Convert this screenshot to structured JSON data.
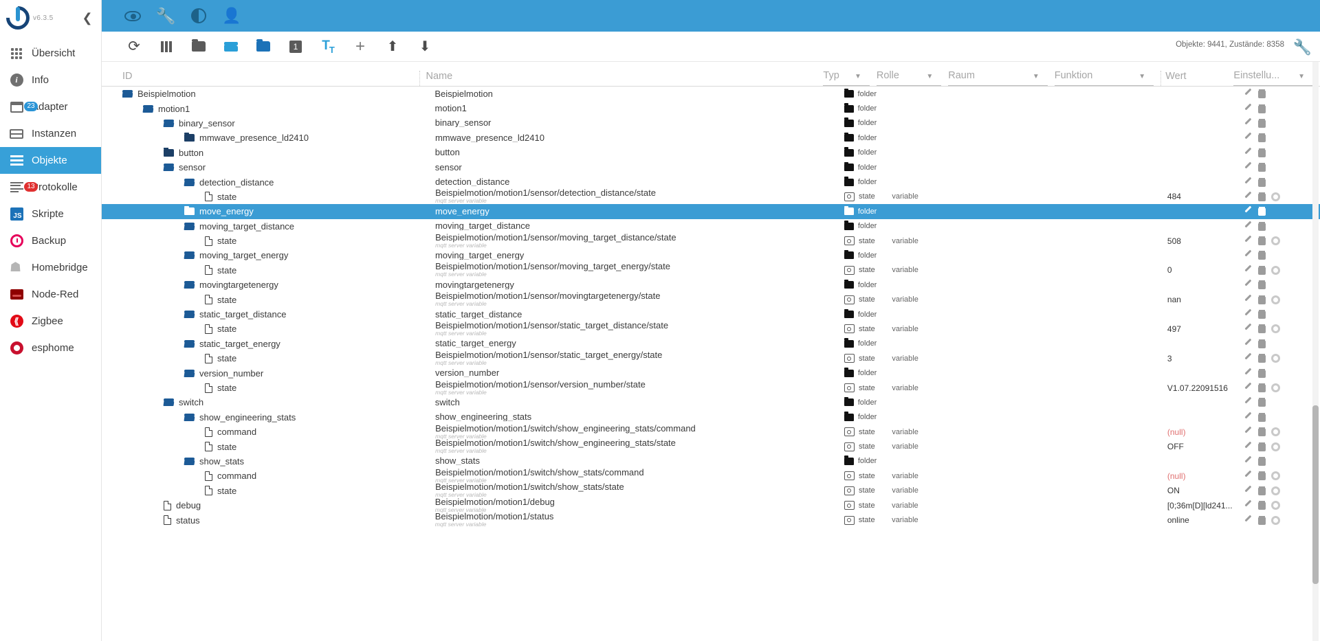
{
  "sidebar": {
    "version": "v6.3.5",
    "collapse_icon": "chevron-left-icon",
    "items": [
      {
        "label": "Übersicht",
        "icon": "grid-icon",
        "active": false,
        "badge": null
      },
      {
        "label": "Info",
        "icon": "info-icon",
        "active": false,
        "badge": null
      },
      {
        "label": "Adapter",
        "icon": "adapter-icon",
        "active": false,
        "badge": "23",
        "badge_color": "#2a94d6"
      },
      {
        "label": "Instanzen",
        "icon": "instance-icon",
        "active": false,
        "badge": null
      },
      {
        "label": "Objekte",
        "icon": "objects-icon",
        "active": true,
        "badge": null
      },
      {
        "label": "Protokolle",
        "icon": "logs-icon",
        "active": false,
        "badge": "13",
        "badge_color": "#e03030"
      },
      {
        "label": "Skripte",
        "icon": "scripts-icon",
        "active": false,
        "badge": null
      },
      {
        "label": "Backup",
        "icon": "backup-icon",
        "active": false,
        "badge": null
      },
      {
        "label": "Homebridge",
        "icon": "homebridge-icon",
        "active": false,
        "badge": null
      },
      {
        "label": "Node-Red",
        "icon": "nodered-icon",
        "active": false,
        "badge": null
      },
      {
        "label": "Zigbee",
        "icon": "zigbee-icon",
        "active": false,
        "badge": null
      },
      {
        "label": "esphome",
        "icon": "esphome-icon",
        "active": false,
        "badge": null
      }
    ]
  },
  "topbar": {
    "accent": "#3b9cd4",
    "icons": [
      "eye-icon",
      "wrench-icon",
      "contrast-icon",
      "user-icon"
    ]
  },
  "toolbar": {
    "icons": [
      "refresh-icon",
      "columns-icon",
      "folder-closed-icon",
      "folder-open-icon",
      "folder-blue-icon",
      "expand-level-1-icon",
      "text-size-icon",
      "plus-icon",
      "upload-icon",
      "download-icon"
    ],
    "expand_level": "1",
    "counts": "Objekte: 9441, Zustände: 8358",
    "settings_icon": "wrench-icon"
  },
  "columns": {
    "id": "ID",
    "name": "Name",
    "typ": "Typ",
    "rolle": "Rolle",
    "raum": "Raum",
    "funktion": "Funktion",
    "wert": "Wert",
    "einstellungen": "Einstellu..."
  },
  "rows": [
    {
      "id": "Beispielmotion",
      "indent": 0,
      "icon": "folder-open-icon",
      "name": "Beispielmotion",
      "sub": "",
      "typ": "folder",
      "typ_icon": "folder-icon",
      "role": "",
      "value": "",
      "gear": false,
      "selected": false
    },
    {
      "id": "motion1",
      "indent": 1,
      "icon": "folder-open-icon",
      "name": "motion1",
      "sub": "",
      "typ": "folder",
      "typ_icon": "folder-icon",
      "role": "",
      "value": "",
      "gear": false,
      "selected": false
    },
    {
      "id": "binary_sensor",
      "indent": 2,
      "icon": "folder-open-icon",
      "name": "binary_sensor",
      "sub": "",
      "typ": "folder",
      "typ_icon": "folder-icon",
      "role": "",
      "value": "",
      "gear": false,
      "selected": false
    },
    {
      "id": "mmwave_presence_ld2410",
      "indent": 3,
      "icon": "folder-closed-icon",
      "name": "mmwave_presence_ld2410",
      "sub": "",
      "typ": "folder",
      "typ_icon": "folder-icon",
      "role": "",
      "value": "",
      "gear": false,
      "selected": false
    },
    {
      "id": "button",
      "indent": 2,
      "icon": "folder-closed-icon",
      "name": "button",
      "sub": "",
      "typ": "folder",
      "typ_icon": "folder-icon",
      "role": "",
      "value": "",
      "gear": false,
      "selected": false
    },
    {
      "id": "sensor",
      "indent": 2,
      "icon": "folder-open-icon",
      "name": "sensor",
      "sub": "",
      "typ": "folder",
      "typ_icon": "folder-icon",
      "role": "",
      "value": "",
      "gear": false,
      "selected": false
    },
    {
      "id": "detection_distance",
      "indent": 3,
      "icon": "folder-open-icon",
      "name": "detection_distance",
      "sub": "",
      "typ": "folder",
      "typ_icon": "folder-icon",
      "role": "",
      "value": "",
      "gear": false,
      "selected": false
    },
    {
      "id": "state",
      "indent": 4,
      "icon": "file-icon",
      "name": "Beispielmotion/motion1/sensor/detection_distance/state",
      "sub": "mqtt server variable",
      "typ": "state",
      "typ_icon": "state-icon",
      "role": "variable",
      "value": "484",
      "gear": true,
      "selected": false
    },
    {
      "id": "move_energy",
      "indent": 3,
      "icon": "folder-closed-icon",
      "name": "move_energy",
      "sub": "",
      "typ": "folder",
      "typ_icon": "folder-icon",
      "role": "",
      "value": "",
      "gear": false,
      "selected": true
    },
    {
      "id": "moving_target_distance",
      "indent": 3,
      "icon": "folder-open-icon",
      "name": "moving_target_distance",
      "sub": "",
      "typ": "folder",
      "typ_icon": "folder-icon",
      "role": "",
      "value": "",
      "gear": false,
      "selected": false
    },
    {
      "id": "state",
      "indent": 4,
      "icon": "file-icon",
      "name": "Beispielmotion/motion1/sensor/moving_target_distance/state",
      "sub": "mqtt server variable",
      "typ": "state",
      "typ_icon": "state-icon",
      "role": "variable",
      "value": "508",
      "gear": true,
      "selected": false
    },
    {
      "id": "moving_target_energy",
      "indent": 3,
      "icon": "folder-open-icon",
      "name": "moving_target_energy",
      "sub": "",
      "typ": "folder",
      "typ_icon": "folder-icon",
      "role": "",
      "value": "",
      "gear": false,
      "selected": false
    },
    {
      "id": "state",
      "indent": 4,
      "icon": "file-icon",
      "name": "Beispielmotion/motion1/sensor/moving_target_energy/state",
      "sub": "mqtt server variable",
      "typ": "state",
      "typ_icon": "state-icon",
      "role": "variable",
      "value": "0",
      "gear": true,
      "selected": false
    },
    {
      "id": "movingtargetenergy",
      "indent": 3,
      "icon": "folder-open-icon",
      "name": "movingtargetenergy",
      "sub": "",
      "typ": "folder",
      "typ_icon": "folder-icon",
      "role": "",
      "value": "",
      "gear": false,
      "selected": false
    },
    {
      "id": "state",
      "indent": 4,
      "icon": "file-icon",
      "name": "Beispielmotion/motion1/sensor/movingtargetenergy/state",
      "sub": "mqtt server variable",
      "typ": "state",
      "typ_icon": "state-icon",
      "role": "variable",
      "value": "nan",
      "gear": true,
      "selected": false
    },
    {
      "id": "static_target_distance",
      "indent": 3,
      "icon": "folder-open-icon",
      "name": "static_target_distance",
      "sub": "",
      "typ": "folder",
      "typ_icon": "folder-icon",
      "role": "",
      "value": "",
      "gear": false,
      "selected": false
    },
    {
      "id": "state",
      "indent": 4,
      "icon": "file-icon",
      "name": "Beispielmotion/motion1/sensor/static_target_distance/state",
      "sub": "mqtt server variable",
      "typ": "state",
      "typ_icon": "state-icon",
      "role": "variable",
      "value": "497",
      "gear": true,
      "selected": false
    },
    {
      "id": "static_target_energy",
      "indent": 3,
      "icon": "folder-open-icon",
      "name": "static_target_energy",
      "sub": "",
      "typ": "folder",
      "typ_icon": "folder-icon",
      "role": "",
      "value": "",
      "gear": false,
      "selected": false
    },
    {
      "id": "state",
      "indent": 4,
      "icon": "file-icon",
      "name": "Beispielmotion/motion1/sensor/static_target_energy/state",
      "sub": "mqtt server variable",
      "typ": "state",
      "typ_icon": "state-icon",
      "role": "variable",
      "value": "3",
      "gear": true,
      "selected": false
    },
    {
      "id": "version_number",
      "indent": 3,
      "icon": "folder-open-icon",
      "name": "version_number",
      "sub": "",
      "typ": "folder",
      "typ_icon": "folder-icon",
      "role": "",
      "value": "",
      "gear": false,
      "selected": false
    },
    {
      "id": "state",
      "indent": 4,
      "icon": "file-icon",
      "name": "Beispielmotion/motion1/sensor/version_number/state",
      "sub": "mqtt server variable",
      "typ": "state",
      "typ_icon": "state-icon",
      "role": "variable",
      "value": "V1.07.22091516",
      "gear": true,
      "selected": false
    },
    {
      "id": "switch",
      "indent": 2,
      "icon": "folder-open-icon",
      "name": "switch",
      "sub": "",
      "typ": "folder",
      "typ_icon": "folder-icon",
      "role": "",
      "value": "",
      "gear": false,
      "selected": false
    },
    {
      "id": "show_engineering_stats",
      "indent": 3,
      "icon": "folder-open-icon",
      "name": "show_engineering_stats",
      "sub": "",
      "typ": "folder",
      "typ_icon": "folder-icon",
      "role": "",
      "value": "",
      "gear": false,
      "selected": false
    },
    {
      "id": "command",
      "indent": 4,
      "icon": "file-icon",
      "name": "Beispielmotion/motion1/switch/show_engineering_stats/command",
      "sub": "mqtt server variable",
      "typ": "state",
      "typ_icon": "state-icon",
      "role": "variable",
      "value": "(null)",
      "value_null": true,
      "gear": true,
      "selected": false
    },
    {
      "id": "state",
      "indent": 4,
      "icon": "file-icon",
      "name": "Beispielmotion/motion1/switch/show_engineering_stats/state",
      "sub": "mqtt server variable",
      "typ": "state",
      "typ_icon": "state-icon",
      "role": "variable",
      "value": "OFF",
      "gear": true,
      "selected": false
    },
    {
      "id": "show_stats",
      "indent": 3,
      "icon": "folder-open-icon",
      "name": "show_stats",
      "sub": "",
      "typ": "folder",
      "typ_icon": "folder-icon",
      "role": "",
      "value": "",
      "gear": false,
      "selected": false
    },
    {
      "id": "command",
      "indent": 4,
      "icon": "file-icon",
      "name": "Beispielmotion/motion1/switch/show_stats/command",
      "sub": "mqtt server variable",
      "typ": "state",
      "typ_icon": "state-icon",
      "role": "variable",
      "value": "(null)",
      "value_null": true,
      "gear": true,
      "selected": false
    },
    {
      "id": "state",
      "indent": 4,
      "icon": "file-icon",
      "name": "Beispielmotion/motion1/switch/show_stats/state",
      "sub": "mqtt server variable",
      "typ": "state",
      "typ_icon": "state-icon",
      "role": "variable",
      "value": "ON",
      "gear": true,
      "selected": false
    },
    {
      "id": "debug",
      "indent": 2,
      "icon": "file-icon",
      "name": "Beispielmotion/motion1/debug",
      "sub": "mqtt server variable",
      "typ": "state",
      "typ_icon": "state-icon",
      "role": "variable",
      "value": "[0;36m[D][ld241...",
      "gear": true,
      "selected": false
    },
    {
      "id": "status",
      "indent": 2,
      "icon": "file-icon",
      "name": "Beispielmotion/motion1/status",
      "sub": "mqtt server variable",
      "typ": "state",
      "typ_icon": "state-icon",
      "role": "variable",
      "value": "online",
      "gear": true,
      "selected": false
    }
  ],
  "row_actions": {
    "edit": "pencil-icon",
    "delete": "trash-icon",
    "settings": "gear-icon"
  }
}
